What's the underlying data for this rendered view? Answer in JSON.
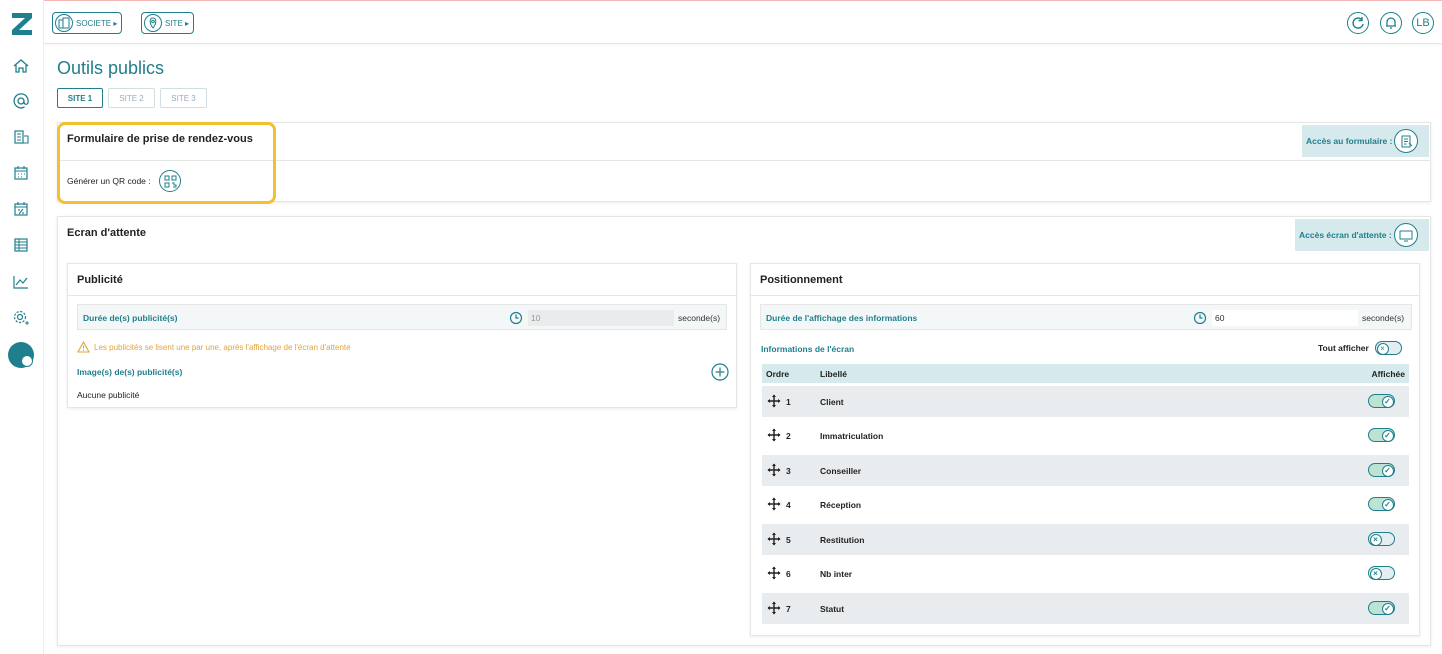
{
  "header": {
    "societe_label": "SOCIETE ▸",
    "site_label": "SITE ▸",
    "user_initials": "LB"
  },
  "sidebar": {
    "items": [
      {
        "name": "home-icon"
      },
      {
        "name": "at-icon"
      },
      {
        "name": "building-list-icon"
      },
      {
        "name": "calendar-icon"
      },
      {
        "name": "calendar-percent-icon"
      },
      {
        "name": "table-icon"
      },
      {
        "name": "chart-line-icon"
      },
      {
        "name": "settings-icon"
      }
    ]
  },
  "page": {
    "title": "Outils publics",
    "tabs": [
      {
        "label": "SITE 1",
        "active": true
      },
      {
        "label": "SITE 2",
        "active": false
      },
      {
        "label": "SITE 3",
        "active": false
      }
    ]
  },
  "form_card": {
    "title": "Formulaire de prise de rendez-vous",
    "qr_label": "Générer un QR code :",
    "access_label": "Accès au formulaire :"
  },
  "waiting_card": {
    "title": "Ecran d'attente",
    "access_label": "Accès écran d'attente :"
  },
  "publicite": {
    "title": "Publicité",
    "duration_label": "Durée de(s) publicité(s)",
    "duration_value": "10",
    "unit": "seconde(s)",
    "warning": "Les publicités se lisent une par une, après l'affichage de l'écran d'attente",
    "images_label": "Image(s) de(s) publicité(s)",
    "empty_text": "Aucune publicité"
  },
  "positionnement": {
    "title": "Positionnement",
    "duration_label": "Durée de l'affichage des informations",
    "duration_value": "60",
    "unit": "seconde(s)",
    "info_label": "Informations de l'écran",
    "show_all_label": "Tout afficher",
    "show_all_on": false,
    "columns": {
      "order": "Ordre",
      "label": "Libellé",
      "shown": "Affichée"
    },
    "rows": [
      {
        "order": "1",
        "label": "Client",
        "shown": true
      },
      {
        "order": "2",
        "label": "Immatriculation",
        "shown": true
      },
      {
        "order": "3",
        "label": "Conseiller",
        "shown": true
      },
      {
        "order": "4",
        "label": "Réception",
        "shown": true
      },
      {
        "order": "5",
        "label": "Restitution",
        "shown": false
      },
      {
        "order": "6",
        "label": "Nb inter",
        "shown": false
      },
      {
        "order": "7",
        "label": "Statut",
        "shown": true
      }
    ]
  },
  "colors": {
    "accent": "#1f7f8c",
    "highlight": "#f2c12e",
    "toggle_on": "#bde3d3",
    "warning": "#e3a33b"
  }
}
